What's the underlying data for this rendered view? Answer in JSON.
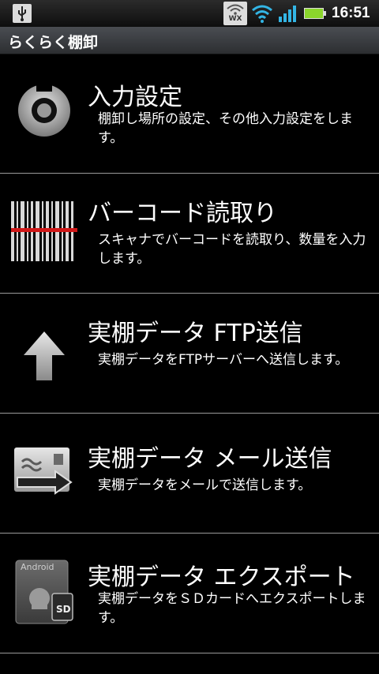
{
  "status_bar": {
    "time": "16:51",
    "wx_label": "WX",
    "icons": [
      "usb-icon",
      "wx-icon",
      "wifi-icon",
      "signal-icon",
      "battery-icon"
    ],
    "battery_color": "#8bd62c",
    "wifi_color": "#33b5e5"
  },
  "app": {
    "title": "らくらく棚卸"
  },
  "menu": {
    "items": [
      {
        "icon": "gear-icon",
        "title": "入力設定",
        "description": "棚卸し場所の設定、その他入力設定をします。"
      },
      {
        "icon": "barcode-icon",
        "title": "バーコード読取り",
        "description": "スキャナでバーコードを読取り、数量を入力します。"
      },
      {
        "icon": "upload-arrow-icon",
        "title": "実棚データ FTP送信",
        "description": "実棚データをFTPサーバーへ送信します。"
      },
      {
        "icon": "mail-send-icon",
        "title": "実棚データ メール送信",
        "description": "実棚データをメールで送信します。"
      },
      {
        "icon": "sd-card-icon",
        "title": "実棚データ エクスポート",
        "description": "実棚データをＳＤカードへエクスポートします。",
        "icon_label_top": "Android",
        "icon_label_card": "SD"
      }
    ]
  }
}
